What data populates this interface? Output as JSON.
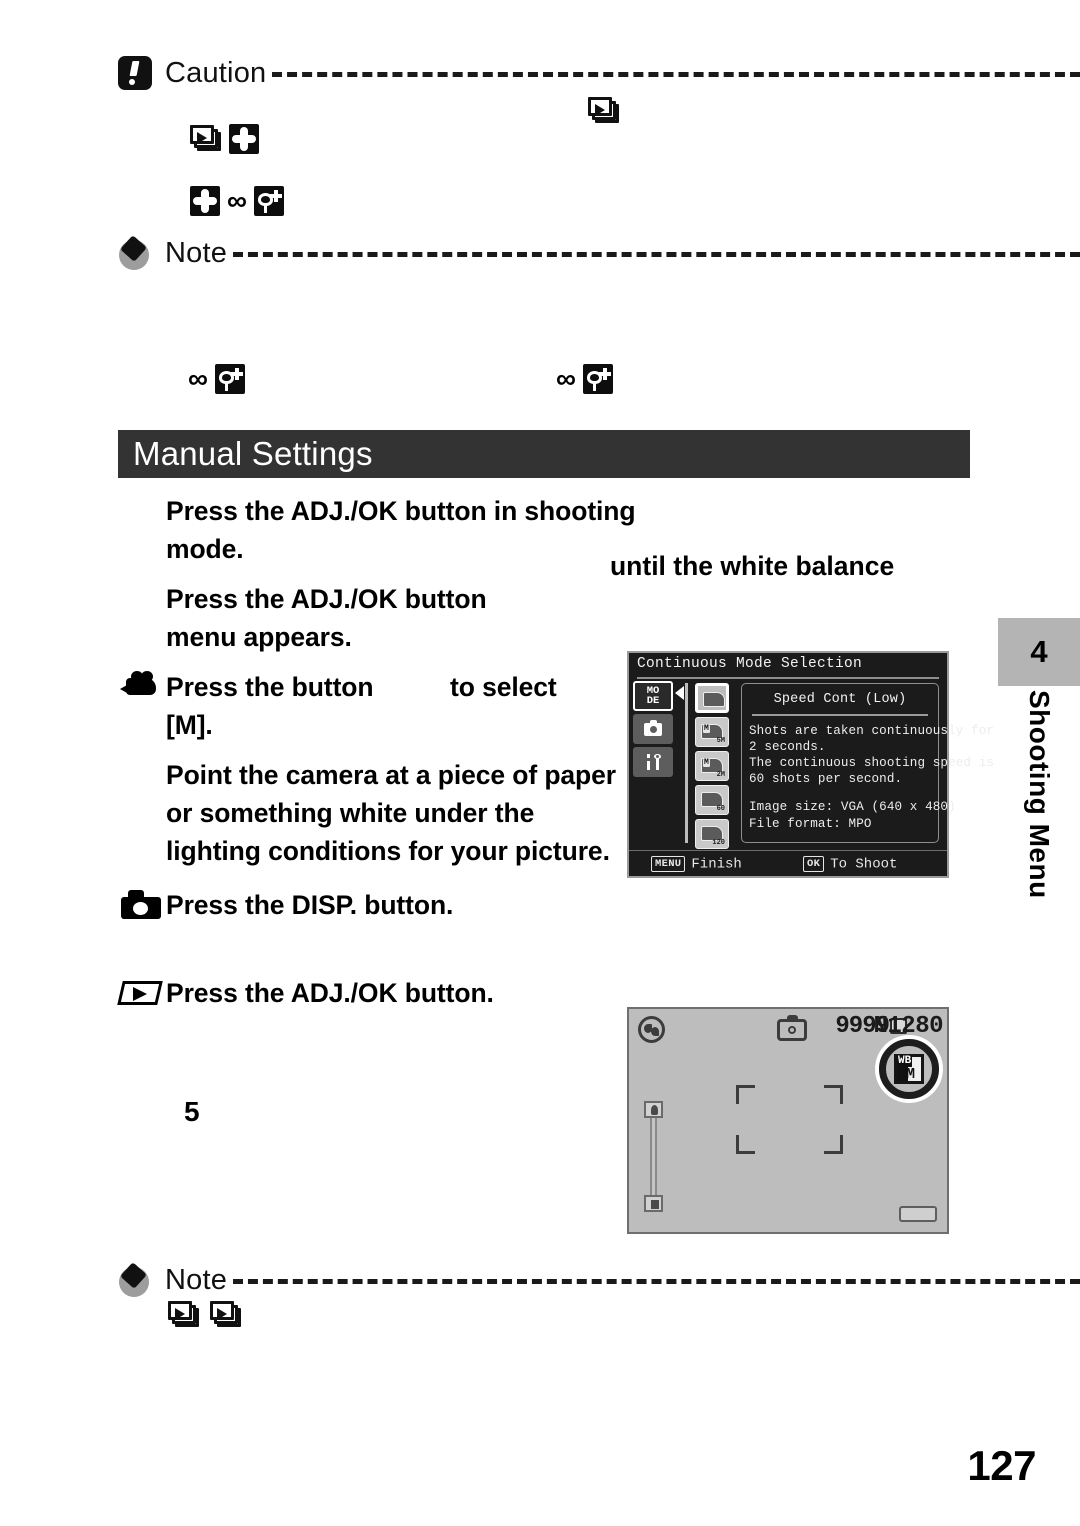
{
  "page": {
    "number": "127",
    "chapter_tab": {
      "number": "4",
      "title": "Shooting Menu"
    }
  },
  "caution_block": {
    "label": "Caution",
    "badge_icon": "caution-exclamation-icon",
    "icon_rows": [
      {
        "icons": [
          "playback-stack-icon",
          "four-way-pad-icon"
        ]
      },
      {
        "icons": [
          "four-way-pad-icon",
          "infinity-icon",
          "macro-flower-icon"
        ]
      }
    ],
    "floating_icons": [
      "playback-stack-icon"
    ]
  },
  "note_block_top": {
    "label": "Note",
    "badge_icon": "note-diamond-icon",
    "icon_rows": [
      {
        "icons": [
          "infinity-icon",
          "macro-flower-icon"
        ]
      },
      {
        "icons": [
          "infinity-icon",
          "macro-flower-icon"
        ]
      }
    ]
  },
  "section": {
    "title": "Manual Settings"
  },
  "steps": [
    {
      "marker": "blank",
      "text": "Press the ADJ./OK button in shooting mode."
    },
    {
      "marker": "blank",
      "text_part1": "Press the ADJ./OK button",
      "text_part2": "until the white balance",
      "text_part3": "menu appears."
    },
    {
      "marker": "camcorder-icon",
      "text_part1": "Press the button",
      "text_part2": "to select",
      "text_part3": "[M]."
    },
    {
      "marker": "blank",
      "text": "Point the camera at a piece of paper or something white under the lighting conditions for your picture."
    },
    {
      "marker": "camera-icon",
      "text": "Press the DISP. button."
    },
    {
      "marker": "play-parallelogram-icon",
      "text": "Press the ADJ./OK button."
    }
  ],
  "loose_numeral": "5",
  "lcd_menu": {
    "title": "Continuous Mode Selection",
    "side_tabs": [
      {
        "label": "MO\nDE",
        "name": "mode-tab",
        "active": true
      },
      {
        "label": "camera-icon",
        "name": "shooting-tab",
        "active": false
      },
      {
        "label": "tools-icon",
        "name": "setup-tab",
        "active": false
      }
    ],
    "mode_icons": [
      {
        "name": "continuous-off-icon",
        "badge": "",
        "selected": true
      },
      {
        "name": "m-cont-5m-icon",
        "badge": "5M",
        "corner": "M",
        "selected": false
      },
      {
        "name": "m-cont-2m-icon",
        "badge": "2M",
        "corner": "M",
        "selected": false
      },
      {
        "name": "speed-cont-60-icon",
        "badge": "60",
        "selected": false
      },
      {
        "name": "speed-cont-120-icon",
        "badge": "120",
        "selected": false
      }
    ],
    "panel": {
      "heading": "Speed Cont (Low)",
      "body_lines": [
        "Shots are taken continuously for",
        "2 seconds.",
        "The continuous shooting speed is",
        "60 shots per second."
      ],
      "spec_lines": [
        "Image size: VGA (640 x 480)",
        "File format: MPO"
      ]
    },
    "status_bar": {
      "left_key": "MENU",
      "left_label": "Finish",
      "right_key": "OK",
      "right_label": "To Shoot"
    }
  },
  "lcd_shooting": {
    "shots_remaining": "9999",
    "quality": "N",
    "image_size": "1280",
    "wb_indicator": {
      "top": "WB",
      "bottom": "M"
    },
    "icons": [
      "scene-mode-icon",
      "still-camera-icon",
      "sd-card-icon",
      "zoom-bar",
      "battery-icon",
      "af-target-frame"
    ]
  },
  "note_block_bottom": {
    "label": "Note",
    "badge_icon": "note-diamond-icon",
    "icon_rows": [
      {
        "icons": [
          "playback-stack-icon",
          "playback-stack-icon"
        ]
      }
    ]
  },
  "colors": {
    "section_bar": "#333333",
    "tab_box": "#b4b4b4",
    "lcd_menu_bg": "#1b1b1b",
    "lcd_shooting_bg": "#bdbdbd"
  }
}
